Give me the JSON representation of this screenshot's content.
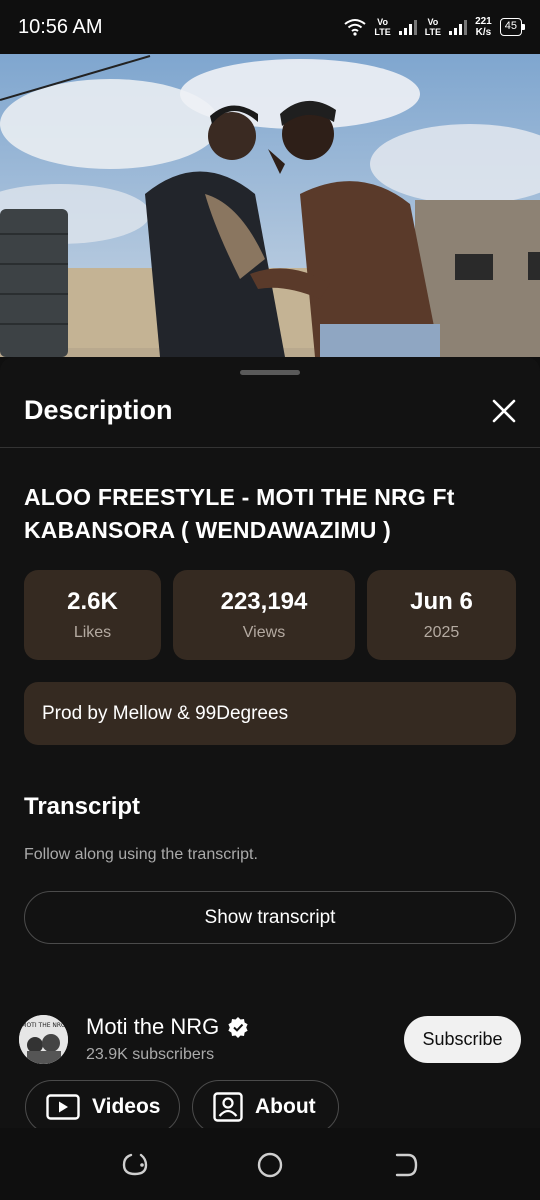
{
  "status_bar": {
    "time": "10:56 AM",
    "sim1": [
      "Vo",
      "LTE"
    ],
    "sim2": [
      "Vo",
      "LTE"
    ],
    "speed": [
      "221",
      "K/s"
    ],
    "battery": "45"
  },
  "sheet": {
    "title": "Description",
    "video_title": "ALOO FREESTYLE - MOTI THE NRG Ft KABANSORA ( WENDAWAZIMU )",
    "stats": [
      {
        "value": "2.6K",
        "label": "Likes"
      },
      {
        "value": "223,194",
        "label": "Views"
      },
      {
        "value": "Jun 6",
        "label": "2025"
      }
    ],
    "description": "Prod by Mellow & 99Degrees",
    "transcript": {
      "title": "Transcript",
      "text": "Follow along using the transcript.",
      "button": "Show transcript"
    },
    "channel": {
      "name": "Moti the NRG",
      "subscribers": "23.9K subscribers",
      "subscribe_label": "Subscribe",
      "avatar_text": "MOTI THE NRG"
    },
    "chips": [
      {
        "label": "Videos",
        "icon": "play-box-icon"
      },
      {
        "label": "About",
        "icon": "person-box-icon"
      }
    ]
  },
  "colors": {
    "background": "#0f0f0f",
    "sheet": "#121212",
    "card": "#352a21",
    "muted_text": "#aaaaaa",
    "subscribe_bg": "#f1f1f1"
  }
}
